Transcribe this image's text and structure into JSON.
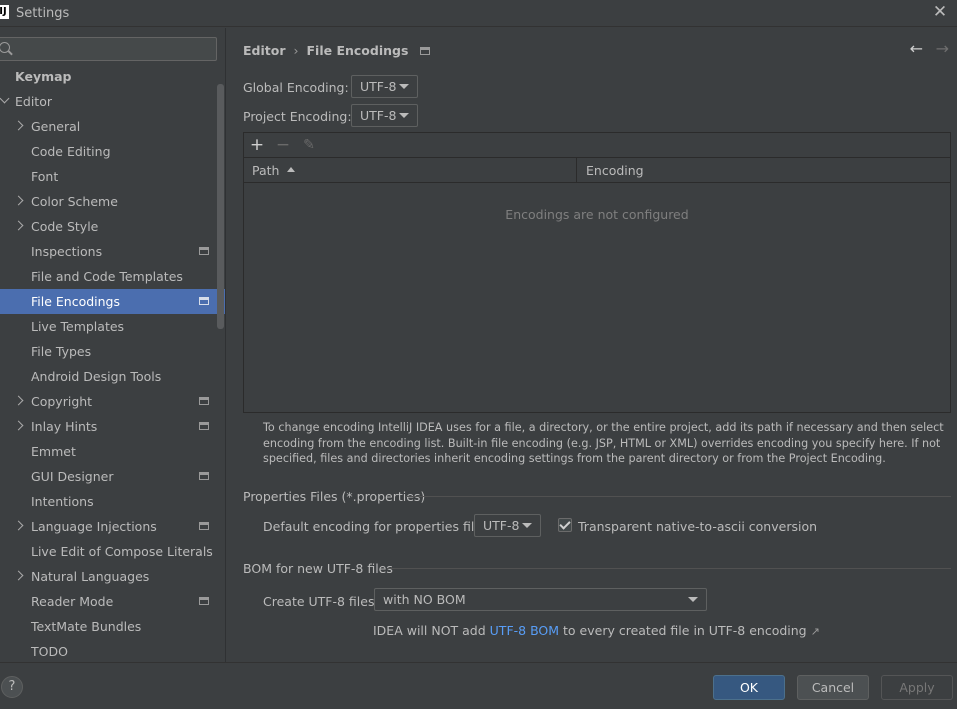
{
  "window": {
    "title": "Settings",
    "logo": "IJ"
  },
  "search": {
    "placeholder": ""
  },
  "sidebar": {
    "items": [
      {
        "label": "Keymap",
        "level": 0,
        "arrow": "none",
        "selected": false,
        "proj": false,
        "bold": true
      },
      {
        "label": "Editor",
        "level": 0,
        "arrow": "down",
        "selected": false,
        "proj": false,
        "bold": false
      },
      {
        "label": "General",
        "level": 1,
        "arrow": "right",
        "selected": false,
        "proj": false
      },
      {
        "label": "Code Editing",
        "level": 1,
        "arrow": "none",
        "selected": false,
        "proj": false
      },
      {
        "label": "Font",
        "level": 1,
        "arrow": "none",
        "selected": false,
        "proj": false
      },
      {
        "label": "Color Scheme",
        "level": 1,
        "arrow": "right",
        "selected": false,
        "proj": false
      },
      {
        "label": "Code Style",
        "level": 1,
        "arrow": "right",
        "selected": false,
        "proj": false
      },
      {
        "label": "Inspections",
        "level": 1,
        "arrow": "none",
        "selected": false,
        "proj": true
      },
      {
        "label": "File and Code Templates",
        "level": 1,
        "arrow": "none",
        "selected": false,
        "proj": false
      },
      {
        "label": "File Encodings",
        "level": 1,
        "arrow": "none",
        "selected": true,
        "proj": true
      },
      {
        "label": "Live Templates",
        "level": 1,
        "arrow": "none",
        "selected": false,
        "proj": false
      },
      {
        "label": "File Types",
        "level": 1,
        "arrow": "none",
        "selected": false,
        "proj": false
      },
      {
        "label": "Android Design Tools",
        "level": 1,
        "arrow": "none",
        "selected": false,
        "proj": false
      },
      {
        "label": "Copyright",
        "level": 1,
        "arrow": "right",
        "selected": false,
        "proj": true
      },
      {
        "label": "Inlay Hints",
        "level": 1,
        "arrow": "right",
        "selected": false,
        "proj": true
      },
      {
        "label": "Emmet",
        "level": 1,
        "arrow": "none",
        "selected": false,
        "proj": false
      },
      {
        "label": "GUI Designer",
        "level": 1,
        "arrow": "none",
        "selected": false,
        "proj": true
      },
      {
        "label": "Intentions",
        "level": 1,
        "arrow": "none",
        "selected": false,
        "proj": false
      },
      {
        "label": "Language Injections",
        "level": 1,
        "arrow": "right",
        "selected": false,
        "proj": true
      },
      {
        "label": "Live Edit of Compose Literals",
        "level": 1,
        "arrow": "none",
        "selected": false,
        "proj": false
      },
      {
        "label": "Natural Languages",
        "level": 1,
        "arrow": "right",
        "selected": false,
        "proj": false
      },
      {
        "label": "Reader Mode",
        "level": 1,
        "arrow": "none",
        "selected": false,
        "proj": true
      },
      {
        "label": "TextMate Bundles",
        "level": 1,
        "arrow": "none",
        "selected": false,
        "proj": false
      },
      {
        "label": "TODO",
        "level": 1,
        "arrow": "none",
        "selected": false,
        "proj": false
      }
    ]
  },
  "breadcrumb": {
    "parent": "Editor",
    "separator": "›",
    "current": "File Encodings"
  },
  "nav": {
    "back": "←",
    "forward": "→"
  },
  "global_encoding": {
    "label": "Global Encoding:",
    "value": "UTF-8"
  },
  "project_encoding": {
    "label": "Project Encoding:",
    "value": "UTF-8"
  },
  "table": {
    "toolbar": {
      "add": "+",
      "remove": "−",
      "edit": "✎"
    },
    "columns": [
      "Path",
      "Encoding"
    ],
    "empty_text": "Encodings are not configured"
  },
  "help_text": "To change encoding IntelliJ IDEA uses for a file, a directory, or the entire project, add its path if necessary and then select encoding from the encoding list. Built-in file encoding (e.g. JSP, HTML or XML) overrides encoding you specify here. If not specified, files and directories inherit encoding settings from the parent directory or from the Project Encoding.",
  "properties": {
    "title": "Properties Files (*.properties)",
    "default_label": "Default encoding for properties files:",
    "default_value": "UTF-8",
    "checkbox_label": "Transparent native-to-ascii conversion",
    "checkbox_checked": true
  },
  "bom": {
    "title": "BOM for new UTF-8 files",
    "create_label": "Create UTF-8 files:",
    "create_value": "with NO BOM",
    "note_prefix": "IDEA will NOT add ",
    "note_link": "UTF-8 BOM",
    "note_suffix": " to every created file in UTF-8 encoding",
    "note_arrow": "↗"
  },
  "footer": {
    "help": "?",
    "ok": "OK",
    "cancel": "Cancel",
    "apply": "Apply"
  },
  "colors": {
    "background": "#3c3f41",
    "selection": "#4b6eaf",
    "link": "#589df6",
    "ok_button": "#365880"
  }
}
